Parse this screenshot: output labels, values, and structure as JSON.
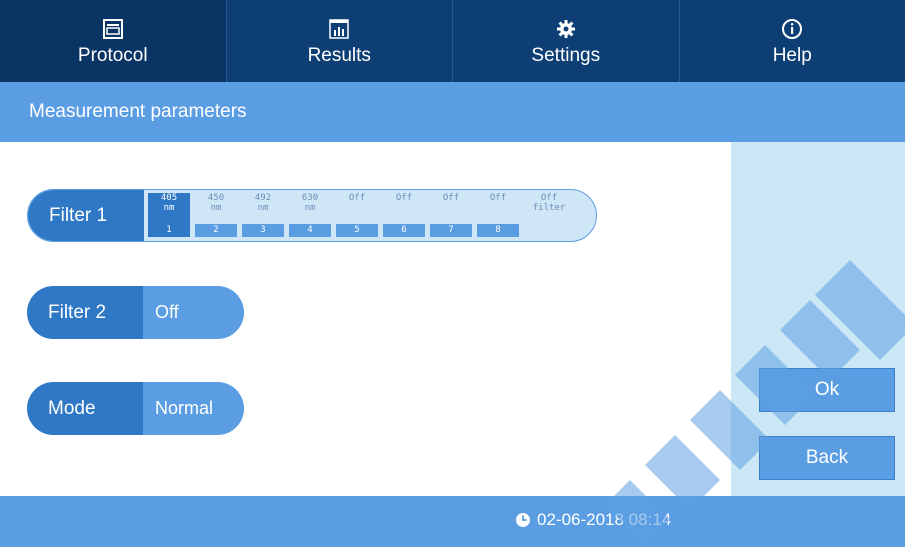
{
  "tabs": [
    {
      "label": "Protocol",
      "icon": "protocol-icon"
    },
    {
      "label": "Results",
      "icon": "results-chart-icon"
    },
    {
      "label": "Settings",
      "icon": "gear-icon"
    },
    {
      "label": "Help",
      "icon": "info-icon"
    }
  ],
  "page": {
    "title": "Measurement parameters"
  },
  "filter1": {
    "label": "Filter 1",
    "selected_index": 0,
    "slots": [
      {
        "wl": "405",
        "unit": "nm",
        "num": "1"
      },
      {
        "wl": "450",
        "unit": "nm",
        "num": "2"
      },
      {
        "wl": "492",
        "unit": "nm",
        "num": "3"
      },
      {
        "wl": "630",
        "unit": "nm",
        "num": "4"
      },
      {
        "wl": "Off",
        "unit": "",
        "num": "5"
      },
      {
        "wl": "Off",
        "unit": "",
        "num": "6"
      },
      {
        "wl": "Off",
        "unit": "",
        "num": "7"
      },
      {
        "wl": "Off",
        "unit": "",
        "num": "8"
      },
      {
        "wl": "Off",
        "unit": "filter",
        "num": ""
      }
    ]
  },
  "filter2": {
    "label": "Filter 2",
    "value": "Off"
  },
  "mode": {
    "label": "Mode",
    "value": "Normal"
  },
  "buttons": {
    "ok": "Ok",
    "back": "Back"
  },
  "status": {
    "datetime": "02-06-2018 08:14"
  },
  "colors": {
    "nav_dark": "#0d3f74",
    "accent": "#5a9de2",
    "pill_dark": "#2f78c5",
    "panel_light": "#cbe6f5"
  }
}
